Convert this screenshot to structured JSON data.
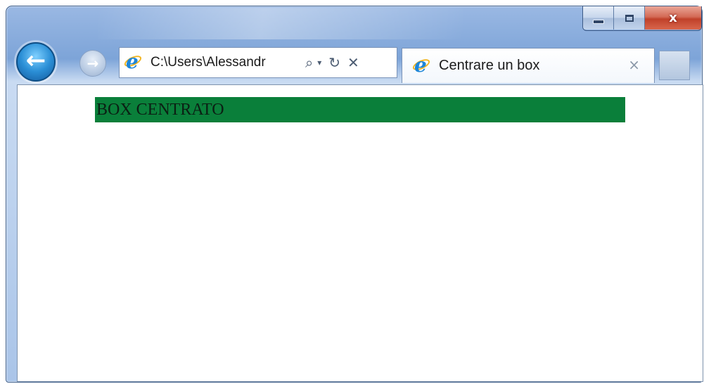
{
  "window": {
    "caption_buttons": [
      "minimize-icon",
      "maximize-icon",
      "close-icon"
    ],
    "close_glyph": "x"
  },
  "navigation": {
    "back_icon": "back-arrow-icon",
    "forward_icon": "forward-arrow-icon",
    "back_glyph": "←",
    "forward_glyph": "→"
  },
  "address_bar": {
    "value": "C:\\Users\\Alessandr",
    "icons": [
      "search-icon",
      "dropdown-icon",
      "refresh-icon",
      "stop-icon"
    ],
    "search_glyph": "⌕",
    "dropdown_glyph": "▾",
    "refresh_glyph": "↻",
    "stop_glyph": "✕"
  },
  "tab": {
    "title": "Centrare un box",
    "close_glyph": "×"
  },
  "page": {
    "box_text": "BOX CENTRATO"
  },
  "colors": {
    "box_background": "#0a7f3a",
    "box_text": "#0b2014",
    "chrome_blue": "#9ab8e3",
    "close_red": "#c0412a"
  }
}
